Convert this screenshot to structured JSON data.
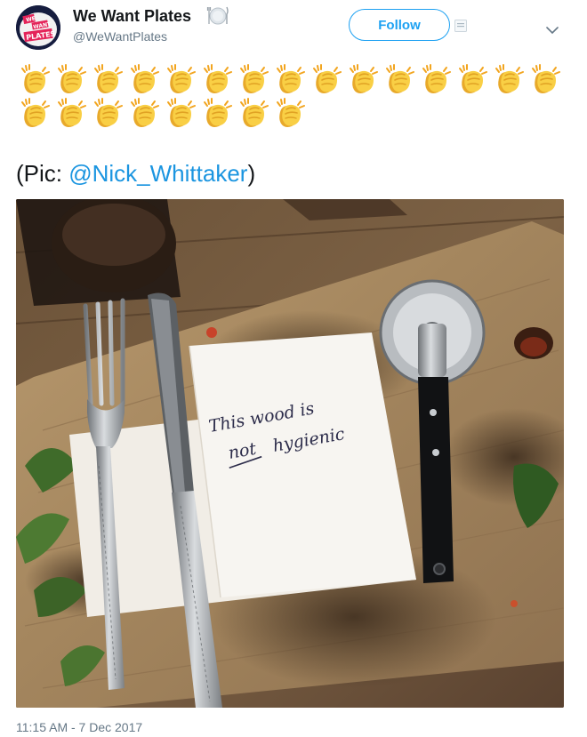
{
  "account": {
    "display_name": "We Want Plates",
    "display_name_emoji": "fork-knife-plate-icon",
    "handle": "@WeWantPlates",
    "avatar_text_lines": [
      "WE",
      "WANT",
      "PLATES"
    ]
  },
  "header": {
    "follow_label": "Follow"
  },
  "tweet": {
    "emoji_rows": [
      15,
      8
    ],
    "emoji_icon": "clapping-hands-icon",
    "credit_prefix": "(Pic: ",
    "credit_mention": "@Nick_Whittaker",
    "credit_suffix": ")",
    "photo": {
      "note_line_1": "This wood is",
      "note_line_2_a": "not",
      "note_line_2_b": "hygienic"
    },
    "timestamp": "11:15 AM - 7 Dec 2017"
  },
  "colors": {
    "accent": "#1da1f2",
    "mention": "#1b95e0",
    "muted": "#657786",
    "clap_yellow": "#f7c63a"
  }
}
